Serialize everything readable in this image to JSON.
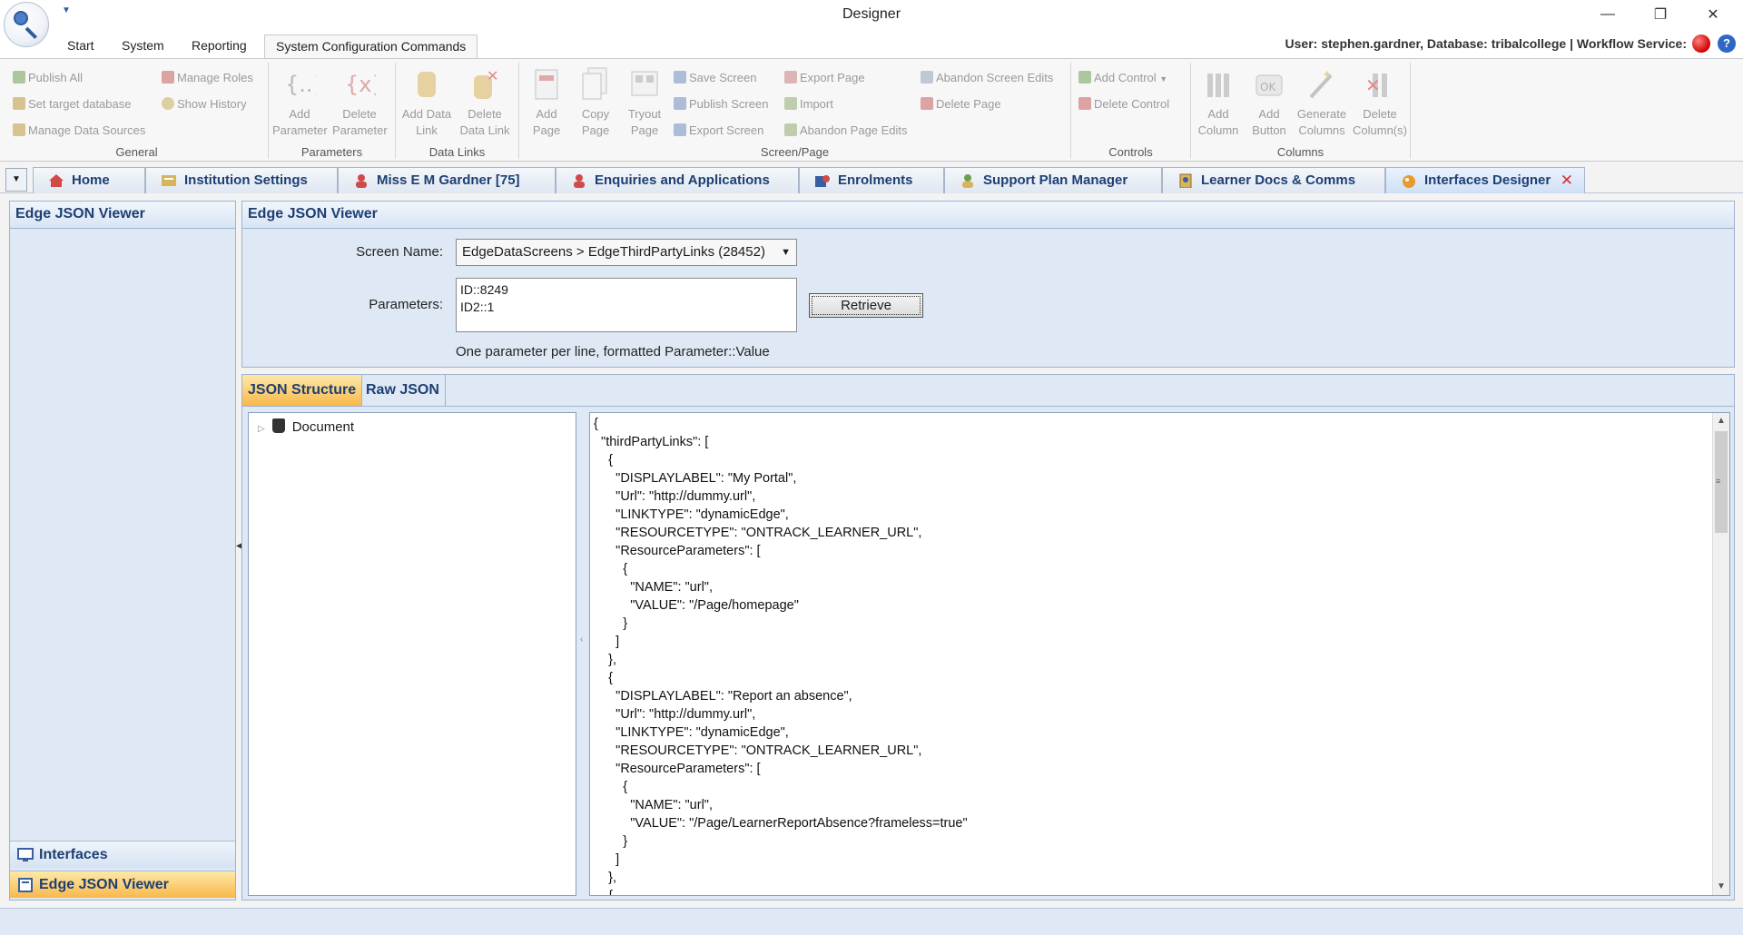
{
  "window": {
    "title": "Designer",
    "minimize": "—",
    "restore": "❐",
    "close": "✕"
  },
  "ribbon_tabs": [
    {
      "label": "Start"
    },
    {
      "label": "System"
    },
    {
      "label": "Reporting"
    },
    {
      "label": "System Configuration Commands",
      "active": true
    }
  ],
  "session": {
    "user_info": "User: stephen.gardner, Database: tribalcollege   |   Workflow Service:",
    "workflow_status_color": "#d00000",
    "help": "?"
  },
  "ribbon": {
    "general": {
      "label": "General",
      "publish_all": "Publish All",
      "set_target_database": "Set target database",
      "manage_data_sources": "Manage Data Sources",
      "manage_roles": "Manage Roles",
      "show_history": "Show History"
    },
    "parameters": {
      "label": "Parameters",
      "add_parameter": [
        "Add",
        "Parameter"
      ],
      "delete_parameter": [
        "Delete",
        "Parameter"
      ]
    },
    "data_links": {
      "label": "Data Links",
      "add_data_link": [
        "Add Data",
        "Link"
      ],
      "delete_data_link": [
        "Delete",
        "Data Link"
      ]
    },
    "screen_page": {
      "label": "Screen/Page",
      "add_page": [
        "Add",
        "Page"
      ],
      "copy_page": [
        "Copy",
        "Page"
      ],
      "tryout_page": [
        "Tryout",
        "Page"
      ],
      "save_screen": "Save Screen",
      "publish_screen": "Publish Screen",
      "export_screen": "Export Screen",
      "export_page": "Export Page",
      "import": "Import",
      "abandon_page_edits": "Abandon Page Edits",
      "abandon_screen_edits": "Abandon Screen Edits",
      "delete_page": "Delete Page"
    },
    "controls": {
      "label": "Controls",
      "add_control": "Add Control",
      "delete_control": "Delete Control"
    },
    "columns": {
      "label": "Columns",
      "add_column": [
        "Add",
        "Column"
      ],
      "add_button": [
        "Add",
        "Button"
      ],
      "generate_columns": [
        "Generate",
        "Columns"
      ],
      "delete_columns": [
        "Delete",
        "Column(s)"
      ]
    }
  },
  "doc_tabs": [
    {
      "label": "Home",
      "icon": "home-icon"
    },
    {
      "label": "Institution Settings",
      "icon": "settings-icon"
    },
    {
      "label": "Miss E M Gardner [75]",
      "icon": "person-icon"
    },
    {
      "label": "Enquiries and Applications",
      "icon": "person-icon"
    },
    {
      "label": "Enrolments",
      "icon": "enrolment-icon"
    },
    {
      "label": "Support Plan Manager",
      "icon": "support-icon"
    },
    {
      "label": "Learner Docs & Comms",
      "icon": "docs-icon"
    },
    {
      "label": "Interfaces Designer",
      "icon": "designer-icon",
      "active": true,
      "close": "✕"
    }
  ],
  "left_nav": {
    "header": "Edge JSON Viewer",
    "items": [
      {
        "label": "Interfaces",
        "icon": "monitor-icon"
      },
      {
        "label": "Edge JSON Viewer",
        "icon": "viewer-icon",
        "selected": true
      }
    ]
  },
  "viewer": {
    "title": "Edge JSON Viewer",
    "screen_name_label": "Screen Name:",
    "screen_name_value": "EdgeDataScreens > EdgeThirdPartyLinks (28452)",
    "parameters_label": "Parameters:",
    "parameters_value": "ID::8249\nID2::1",
    "retrieve_label": "Retrieve",
    "hint": "One parameter per line, formatted Parameter::Value",
    "tabs": [
      {
        "label": "JSON Structure",
        "active": true
      },
      {
        "label": "Raw JSON"
      }
    ],
    "tree_root": "Document",
    "raw_json": "{\n  \"thirdPartyLinks\": [\n    {\n      \"DISPLAYLABEL\": \"My Portal\",\n      \"Url\": \"http://dummy.url\",\n      \"LINKTYPE\": \"dynamicEdge\",\n      \"RESOURCETYPE\": \"ONTRACK_LEARNER_URL\",\n      \"ResourceParameters\": [\n        {\n          \"NAME\": \"url\",\n          \"VALUE\": \"/Page/homepage\"\n        }\n      ]\n    },\n    {\n      \"DISPLAYLABEL\": \"Report an absence\",\n      \"Url\": \"http://dummy.url\",\n      \"LINKTYPE\": \"dynamicEdge\",\n      \"RESOURCETYPE\": \"ONTRACK_LEARNER_URL\",\n      \"ResourceParameters\": [\n        {\n          \"NAME\": \"url\",\n          \"VALUE\": \"/Page/LearnerReportAbsence?frameless=true\"\n        }\n      ]\n    },\n    {"
  }
}
